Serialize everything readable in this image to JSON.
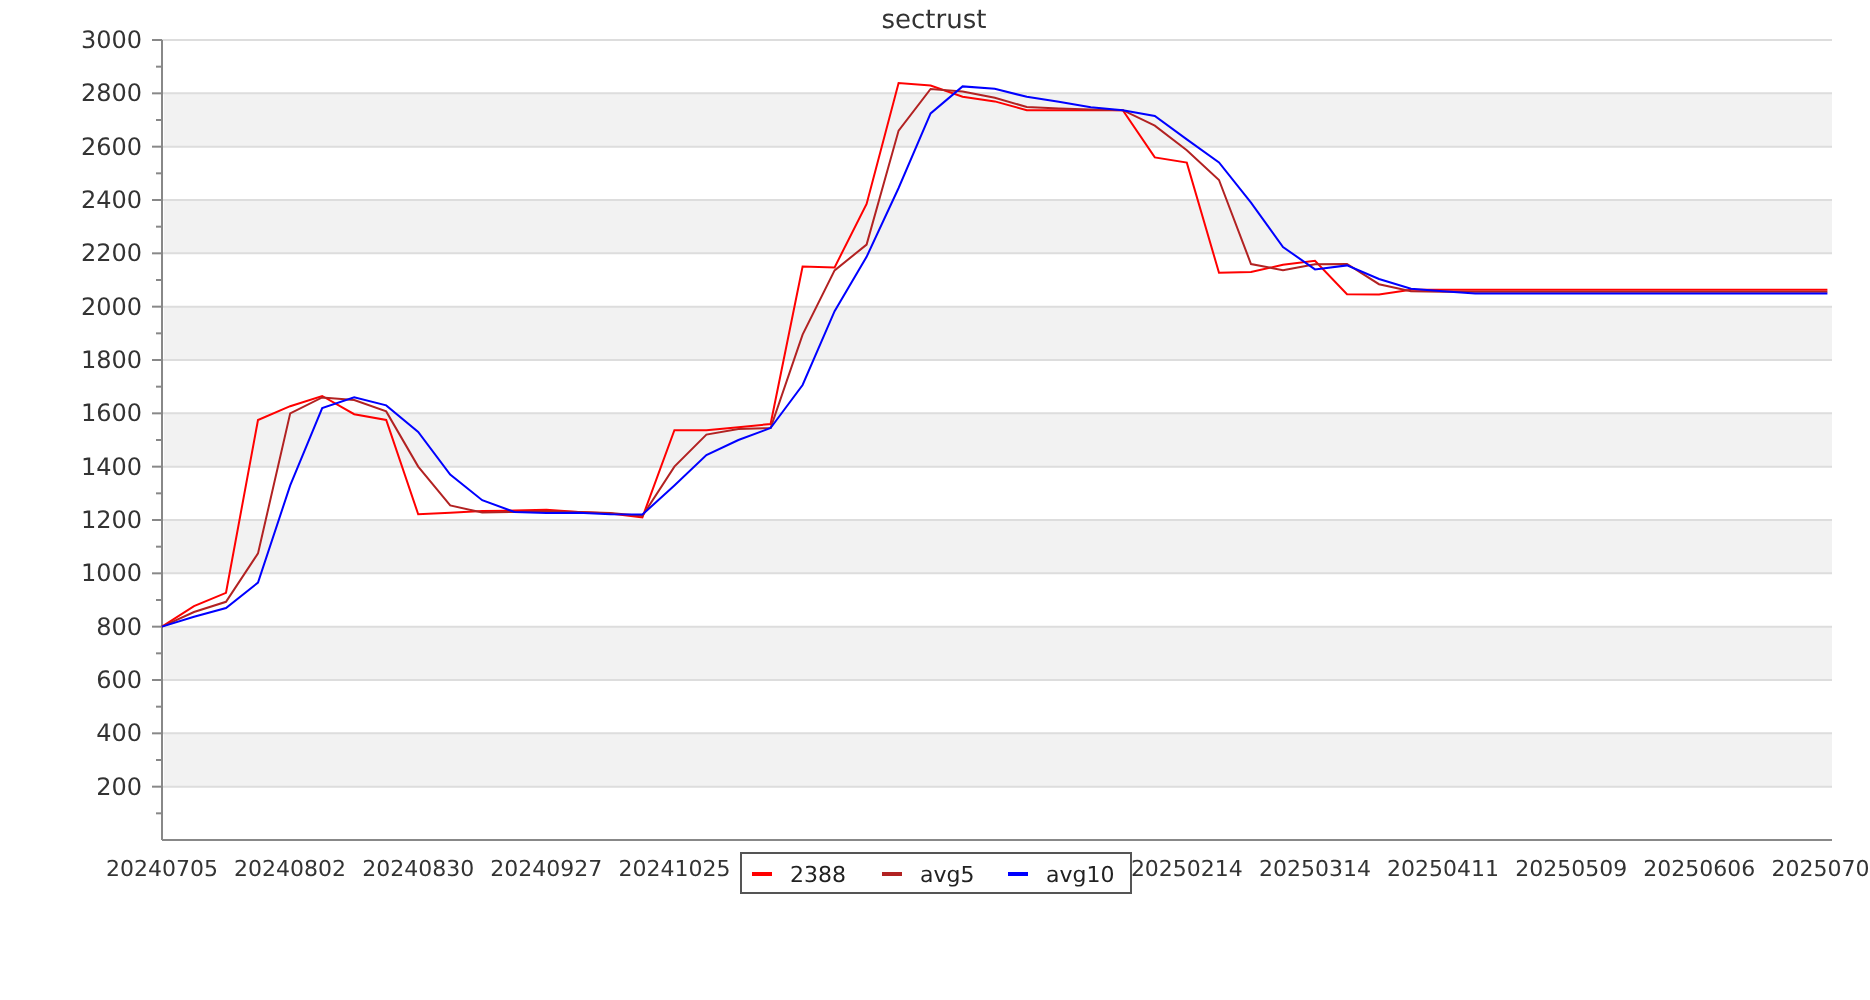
{
  "chart": {
    "chart_data": {
      "type": "line",
      "title": "sectrust",
      "categories": [
        "20240705",
        null,
        null,
        null,
        "20240802",
        null,
        null,
        null,
        "20240830",
        null,
        null,
        null,
        "20240927",
        null,
        null,
        null,
        "20241025",
        null,
        null,
        null,
        null,
        null,
        null,
        null,
        null,
        null,
        null,
        null,
        null,
        null,
        null,
        null,
        "20250214",
        null,
        null,
        null,
        "20250314",
        null,
        null,
        null,
        "20250411",
        null,
        null,
        null,
        "20250509",
        null,
        null,
        null,
        "20250606",
        null,
        null,
        null,
        "2025070"
      ],
      "series": [
        {
          "name": "2388",
          "color": "#ff0000",
          "values": [
            800,
            877,
            927,
            1575,
            1627,
            1665,
            1597,
            1575,
            1222,
            1227,
            1234,
            1235,
            1238,
            1230,
            1225,
            1210,
            1537,
            1537,
            1548,
            1560,
            2150,
            2147,
            2385,
            2839,
            2829,
            2787,
            2770,
            2737,
            2737,
            2737,
            2737,
            2560,
            2540,
            2127,
            2130,
            2157,
            2172,
            2047,
            2046,
            2063,
            2063,
            2063,
            2063,
            2063,
            2063,
            2063,
            2063,
            2063,
            2063,
            2063,
            2063,
            2063,
            2063
          ]
        },
        {
          "name": "avg5",
          "color": "#b22222",
          "values": [
            800,
            855,
            893,
            1075,
            1600,
            1660,
            1650,
            1607,
            1400,
            1255,
            1228,
            1230,
            1233,
            1230,
            1226,
            1215,
            1400,
            1520,
            1541,
            1545,
            1895,
            2136,
            2233,
            2660,
            2816,
            2807,
            2783,
            2749,
            2743,
            2739,
            2737,
            2679,
            2587,
            2475,
            2160,
            2137,
            2159,
            2160,
            2084,
            2058,
            2056,
            2056,
            2056,
            2056,
            2056,
            2056,
            2056,
            2056,
            2056,
            2056,
            2056,
            2056,
            2056
          ]
        },
        {
          "name": "avg10",
          "color": "#0000ff",
          "values": [
            800,
            837,
            870,
            965,
            1330,
            1620,
            1660,
            1630,
            1530,
            1370,
            1274,
            1230,
            1226,
            1227,
            1222,
            1220,
            1330,
            1444,
            1500,
            1545,
            1706,
            1983,
            2187,
            2445,
            2725,
            2826,
            2817,
            2787,
            2768,
            2748,
            2737,
            2715,
            2627,
            2541,
            2390,
            2224,
            2140,
            2155,
            2104,
            2067,
            2058,
            2049,
            2049,
            2049,
            2049,
            2049,
            2049,
            2049,
            2049,
            2049,
            2049,
            2049,
            2049
          ]
        }
      ],
      "grid": true,
      "legend": true,
      "ylim": [
        0,
        3000
      ],
      "yticks": [
        200,
        400,
        600,
        800,
        1000,
        1200,
        1400,
        1600,
        1800,
        2000,
        2200,
        2400,
        2600,
        2800,
        3000
      ]
    }
  }
}
